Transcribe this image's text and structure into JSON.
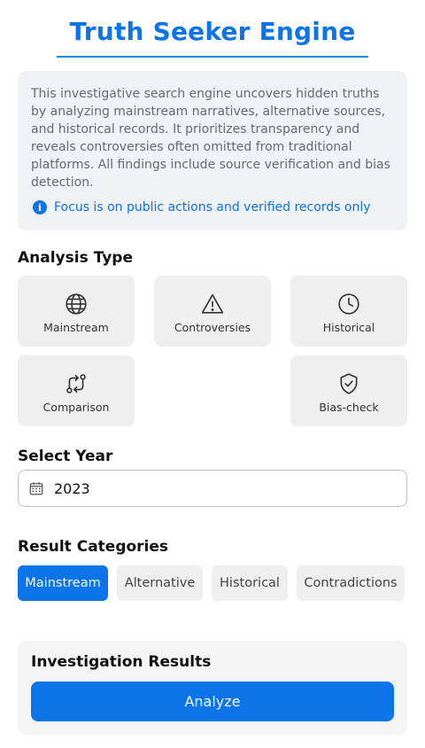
{
  "header": {
    "title": "Truth Seeker Engine"
  },
  "intro": {
    "description": "This investigative search engine uncovers hidden truths by analyzing mainstream narratives, alternative sources, and historical records. It prioritizes transparency and reveals controversies often omitted from traditional platforms. All findings include source verification and bias detection.",
    "note": "Focus is on public actions and verified records only",
    "note_icon": "info-icon"
  },
  "analysis_type": {
    "heading": "Analysis Type",
    "options": [
      {
        "label": "Mainstream",
        "icon": "globe-icon"
      },
      {
        "label": "Controversies",
        "icon": "warning-icon"
      },
      {
        "label": "Historical",
        "icon": "clock-icon"
      },
      {
        "label": "Comparison",
        "icon": "compare-icon"
      },
      {
        "label": "Bias-check",
        "icon": "shield-check-icon"
      }
    ]
  },
  "year": {
    "heading": "Select Year",
    "value": "2023",
    "icon": "calendar-icon"
  },
  "categories": {
    "heading": "Result Categories",
    "items": [
      "Mainstream",
      "Alternative",
      "Historical",
      "Contradictions"
    ],
    "selected": "Mainstream"
  },
  "results": {
    "heading": "Investigation Results",
    "button_label": "Analyze"
  },
  "colors": {
    "accent": "#0a74e8",
    "tile_bg": "#efefef",
    "card_bg": "#f1f2f6"
  }
}
